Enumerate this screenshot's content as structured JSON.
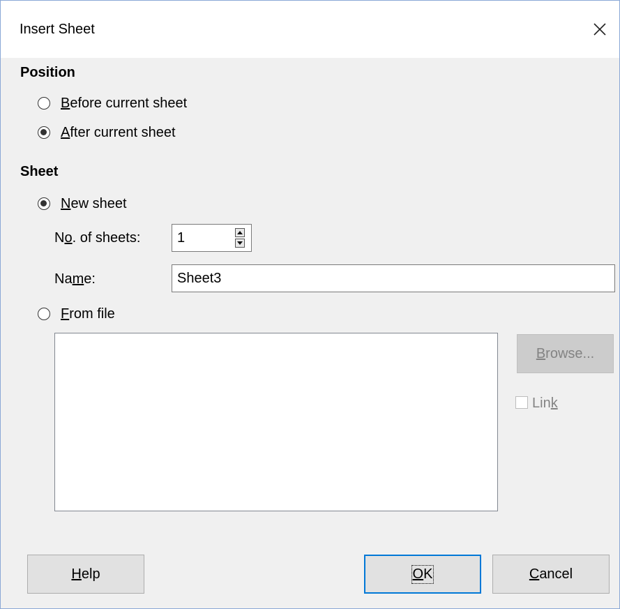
{
  "dialog": {
    "title": "Insert Sheet",
    "close_glyph": "✕"
  },
  "position": {
    "heading": "Position",
    "before_pre": "",
    "before_key": "B",
    "before_post": "efore current sheet",
    "after_pre": "",
    "after_key": "A",
    "after_post": "fter current sheet",
    "selected": "after"
  },
  "sheet": {
    "heading": "Sheet",
    "new_pre": "",
    "new_key": "N",
    "new_post": "ew sheet",
    "count_pre": "N",
    "count_key": "o",
    "count_post": ". of sheets:",
    "count_value": "1",
    "name_pre": "Na",
    "name_key": "m",
    "name_post": "e:",
    "name_value": "Sheet3",
    "fromfile_pre": "",
    "fromfile_key": "F",
    "fromfile_post": "rom file",
    "selected": "new"
  },
  "file": {
    "browse_pre": "",
    "browse_key": "B",
    "browse_post": "rowse...",
    "link_pre": "Lin",
    "link_key": "k",
    "link_post": ""
  },
  "buttons": {
    "help_pre": "",
    "help_key": "H",
    "help_post": "elp",
    "ok_pre": "",
    "ok_key": "O",
    "ok_post": "K",
    "cancel_pre": "",
    "cancel_key": "C",
    "cancel_post": "ancel"
  },
  "colors": {
    "accent": "#0078d7",
    "border": "#8aa8d6",
    "background": "#f0f0f0"
  },
  "icons": {
    "close": "close-icon",
    "spin_up": "spin-up-icon",
    "spin_down": "spin-down-icon"
  }
}
